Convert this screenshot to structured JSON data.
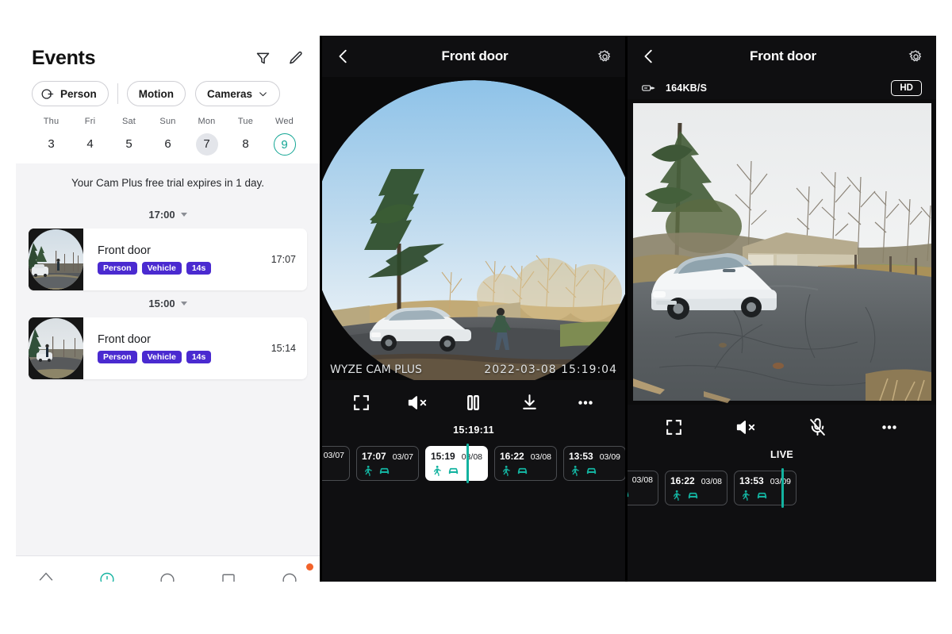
{
  "events_panel": {
    "title": "Events",
    "actions": [
      {
        "name": "filter-icon",
        "label": "Filter"
      },
      {
        "name": "edit-icon",
        "label": "Edit"
      }
    ],
    "filters": [
      {
        "label": "Person",
        "icon": "person-plus-icon"
      },
      {
        "label": "Motion",
        "icon": ""
      },
      {
        "label": "Cameras",
        "icon": "chevron-down-icon"
      }
    ],
    "week": [
      {
        "dow": "Thu",
        "num": "3",
        "state": "normal"
      },
      {
        "dow": "Fri",
        "num": "4",
        "state": "normal"
      },
      {
        "dow": "Sat",
        "num": "5",
        "state": "normal"
      },
      {
        "dow": "Sun",
        "num": "6",
        "state": "normal"
      },
      {
        "dow": "Mon",
        "num": "7",
        "state": "selected"
      },
      {
        "dow": "Tue",
        "num": "8",
        "state": "normal"
      },
      {
        "dow": "Wed",
        "num": "9",
        "state": "today"
      }
    ],
    "trial_notice": "Your Cam Plus free trial expires in 1 day.",
    "groups": [
      {
        "hour": "17:00",
        "events": [
          {
            "camera": "Front door",
            "tags": [
              "Person",
              "Vehicle",
              "14s"
            ],
            "time": "17:07"
          }
        ]
      },
      {
        "hour": "15:00",
        "events": [
          {
            "camera": "Front door",
            "tags": [
              "Person",
              "Vehicle",
              "14s"
            ],
            "time": "15:14"
          }
        ]
      }
    ],
    "bottom_nav": [
      {
        "name": "nav-home-icon"
      },
      {
        "name": "nav-events-icon"
      },
      {
        "name": "nav-add-icon"
      },
      {
        "name": "nav-discover-icon"
      },
      {
        "name": "nav-account-icon"
      }
    ]
  },
  "playback_panel": {
    "title": "Front door",
    "back_icon": "chevron-left-icon",
    "settings_icon": "gear-icon",
    "watermark": "WYZE CAM PLUS",
    "video_timestamp": "2022-03-08 15:19:04",
    "controls": [
      {
        "name": "fullscreen-button",
        "label": "Fullscreen"
      },
      {
        "name": "mute-button",
        "label": "Sound off"
      },
      {
        "name": "pause-button",
        "label": "Pause"
      },
      {
        "name": "download-button",
        "label": "Download"
      },
      {
        "name": "more-button",
        "label": "More"
      }
    ],
    "play_position": "15:19:11",
    "timeline": [
      {
        "time": "",
        "date": "03/07",
        "active": false,
        "partial": true
      },
      {
        "time": "17:07",
        "date": "03/07",
        "active": false,
        "partial": false
      },
      {
        "time": "15:19",
        "date": "03/08",
        "active": true,
        "partial": false
      },
      {
        "time": "16:22",
        "date": "03/08",
        "active": false,
        "partial": false
      },
      {
        "time": "13:53",
        "date": "03/09",
        "active": false,
        "partial": false
      }
    ]
  },
  "live_panel": {
    "title": "Front door",
    "back_icon": "chevron-left-icon",
    "settings_icon": "gear-icon",
    "bitrate": "164KB/S",
    "bitrate_icon": "network-speed-icon",
    "quality": "HD",
    "controls": [
      {
        "name": "fullscreen-button",
        "label": "Fullscreen"
      },
      {
        "name": "mute-button",
        "label": "Sound off"
      },
      {
        "name": "mic-button",
        "label": "Microphone off"
      },
      {
        "name": "more-button",
        "label": "More"
      }
    ],
    "play_position": "LIVE",
    "timeline": [
      {
        "time": "",
        "date": "03/08",
        "active": false,
        "partial": true
      },
      {
        "time": "16:22",
        "date": "03/08",
        "active": false,
        "partial": false
      },
      {
        "time": "13:53",
        "date": "03/09",
        "active": false,
        "partial": false
      }
    ]
  },
  "colors": {
    "accent_teal": "#13b3a0",
    "tag_purple": "#4a2ad0",
    "panel_bg": "#f4f4f6",
    "dark_bg": "#0f0f11",
    "notif_orange": "#f2622a"
  }
}
